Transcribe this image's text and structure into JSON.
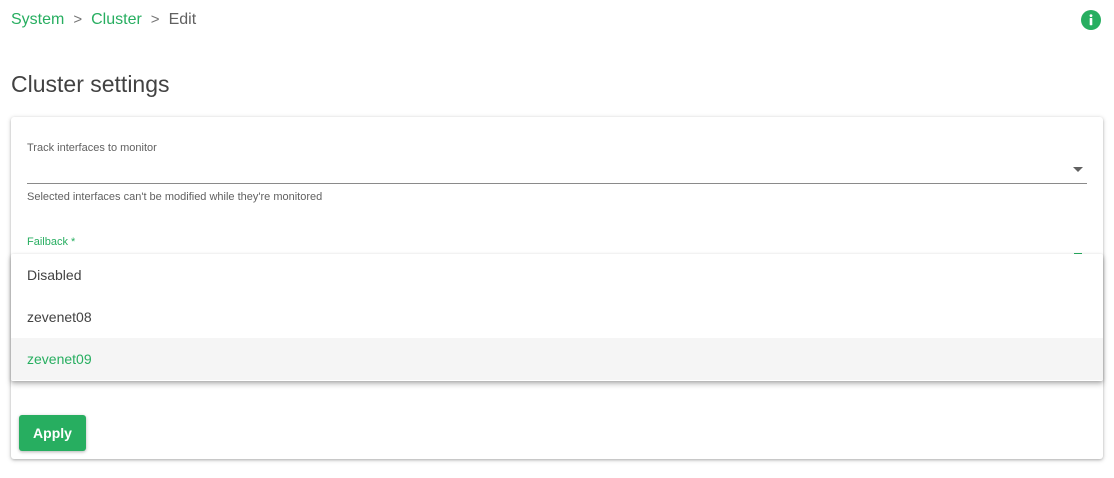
{
  "breadcrumb": {
    "items": [
      {
        "label": "System"
      },
      {
        "label": "Cluster"
      }
    ],
    "separator": ">",
    "current": "Edit"
  },
  "page": {
    "title": "Cluster settings"
  },
  "form": {
    "track_interfaces": {
      "label": "Track interfaces to monitor",
      "value": "",
      "helper": "Selected interfaces can't be modified while they're monitored"
    },
    "failback": {
      "label": "Failback *",
      "options": [
        "Disabled",
        "zevenet08",
        "zevenet09"
      ],
      "selected": "zevenet09"
    },
    "apply_label": "Apply"
  },
  "icons": {
    "info": "info-icon",
    "dropdown_arrow": "chevron-down-icon"
  },
  "colors": {
    "accent": "#27ae60",
    "text": "#424242",
    "muted": "#616161",
    "selected_bg": "#f5f5f5"
  }
}
